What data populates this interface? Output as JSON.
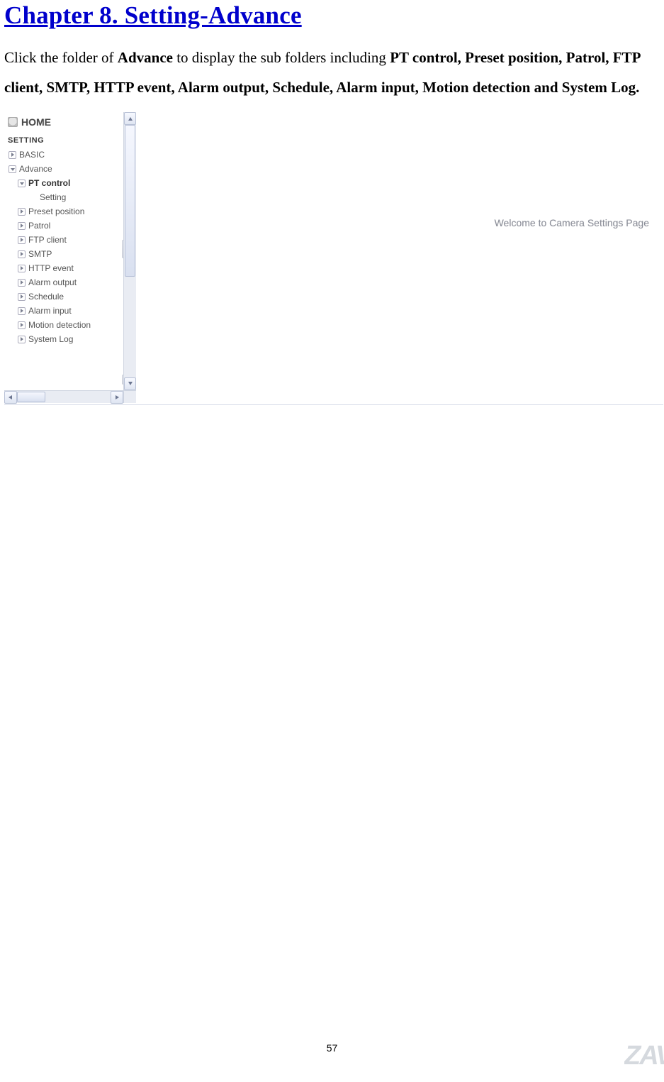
{
  "chapter": {
    "title": "Chapter 8. Setting-Advance"
  },
  "intro": {
    "prefix": "Click the folder of ",
    "bold1": "Advance",
    "middle": " to display the sub folders including ",
    "bold2": "PT control, Preset position, Patrol, FTP client, SMTP, HTTP event, Alarm output, Schedule, Alarm input, Motion detection and System Log."
  },
  "sidebar": {
    "home": "HOME",
    "setting_header": "SETTING",
    "items": [
      {
        "label": "BASIC",
        "level": 1,
        "open": false,
        "bold": false,
        "hasIcon": true
      },
      {
        "label": "Advance",
        "level": 1,
        "open": true,
        "bold": false,
        "hasIcon": true
      },
      {
        "label": "PT control",
        "level": 2,
        "open": true,
        "bold": true,
        "hasIcon": true
      },
      {
        "label": "Setting",
        "level": 3,
        "open": false,
        "bold": false,
        "hasIcon": false
      },
      {
        "label": "Preset position",
        "level": 2,
        "open": false,
        "bold": false,
        "hasIcon": true
      },
      {
        "label": "Patrol",
        "level": 2,
        "open": false,
        "bold": false,
        "hasIcon": true
      },
      {
        "label": "FTP client",
        "level": 2,
        "open": false,
        "bold": false,
        "hasIcon": true
      },
      {
        "label": "SMTP",
        "level": 2,
        "open": false,
        "bold": false,
        "hasIcon": true
      },
      {
        "label": "HTTP event",
        "level": 2,
        "open": false,
        "bold": false,
        "hasIcon": true
      },
      {
        "label": "Alarm output",
        "level": 2,
        "open": false,
        "bold": false,
        "hasIcon": true
      },
      {
        "label": "Schedule",
        "level": 2,
        "open": false,
        "bold": false,
        "hasIcon": true
      },
      {
        "label": "Alarm input",
        "level": 2,
        "open": false,
        "bold": false,
        "hasIcon": true
      },
      {
        "label": "Motion detection",
        "level": 2,
        "open": false,
        "bold": false,
        "hasIcon": true
      },
      {
        "label": "System Log",
        "level": 2,
        "open": false,
        "bold": false,
        "hasIcon": true
      }
    ]
  },
  "content": {
    "welcome": "Welcome to Camera Settings Page"
  },
  "footer": {
    "page_number": "57",
    "watermark": "ZAV"
  }
}
